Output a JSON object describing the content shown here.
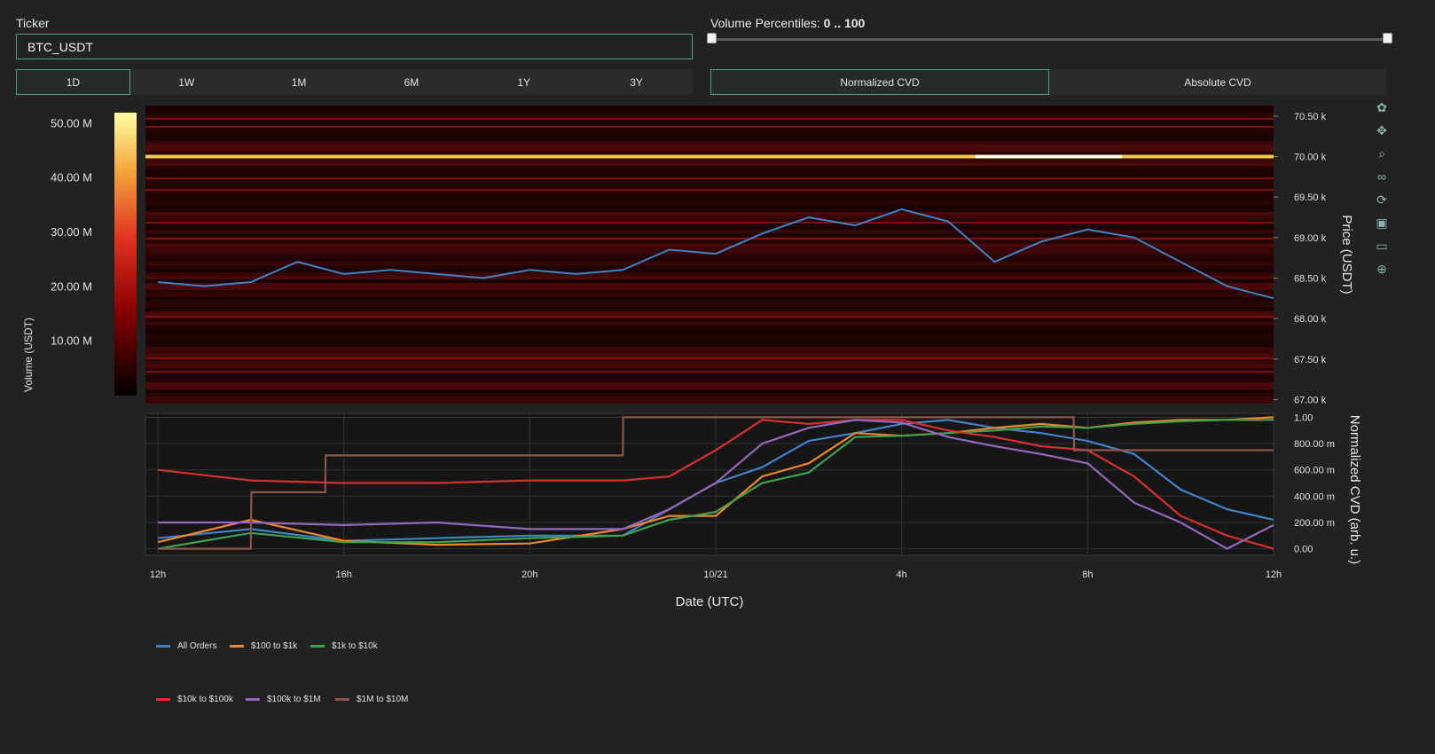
{
  "ticker": {
    "label": "Ticker",
    "value": "BTC_USDT"
  },
  "timeframes": [
    "1D",
    "1W",
    "1M",
    "6M",
    "1Y",
    "3Y"
  ],
  "timeframe_selected": "1D",
  "volume_percentiles": {
    "label": "Volume Percentiles:",
    "value": "0 .. 100",
    "min": 0,
    "max": 100
  },
  "cvd_modes": [
    "Normalized CVD",
    "Absolute CVD"
  ],
  "cvd_mode_selected": "Normalized CVD",
  "colorbar": {
    "title": "Volume (USDT)",
    "ticks": [
      "50.00 M",
      "40.00 M",
      "30.00 M",
      "20.00 M",
      "10.00 M"
    ],
    "tick_values": [
      50,
      40,
      30,
      20,
      10
    ],
    "max": 52,
    "colors": [
      "#000000",
      "#8a0000",
      "#e03020",
      "#f4a83a",
      "#ffffa0"
    ]
  },
  "icons": [
    "plotly-logo-icon",
    "pan-icon",
    "zoom-icon",
    "lasso-icon",
    "reset-axes-icon",
    "download-icon",
    "comment-icon",
    "crosshair-icon"
  ],
  "chart_data": [
    {
      "type": "heatmap",
      "ylabel": "Price (USDT)",
      "yticks": [
        "70.50 k",
        "70.00 k",
        "69.50 k",
        "69.00 k",
        "68.50 k",
        "68.00 k",
        "67.50 k",
        "67.00 k"
      ],
      "ylim": [
        66950,
        70630
      ],
      "strong_levels": [
        70000
      ],
      "series": [
        {
          "name": "Price",
          "color": "#3f83c8",
          "x": [
            0,
            1,
            2,
            3,
            4,
            5,
            6,
            7,
            8,
            9,
            10,
            11,
            12,
            13,
            14,
            15,
            16,
            17,
            18,
            19,
            20,
            21,
            22,
            23,
            24
          ],
          "y": [
            68450,
            68400,
            68450,
            68700,
            68550,
            68600,
            68550,
            68500,
            68600,
            68550,
            68600,
            68850,
            68800,
            69050,
            69250,
            69150,
            69350,
            69200,
            68700,
            68950,
            69100,
            69000,
            68700,
            68400,
            68250
          ]
        }
      ]
    },
    {
      "type": "line",
      "xlabel": "Date (UTC)",
      "ylabel": "Normalized CVD (arb. u.)",
      "xticks": [
        "12h",
        "16h",
        "20h",
        "10/21",
        "4h",
        "8h",
        "12h"
      ],
      "yticks": [
        "1.00",
        "800.00 m",
        "600.00 m",
        "400.00 m",
        "200.00 m",
        "0.00"
      ],
      "xlim": [
        0,
        24
      ],
      "ylim": [
        -0.05,
        1.03
      ],
      "series": [
        {
          "name": "All Orders",
          "color": "#3f83c8",
          "x": [
            0,
            2,
            4,
            6,
            8,
            10,
            11,
            12,
            13,
            14,
            15,
            16,
            17,
            18,
            19,
            20,
            21,
            22,
            23,
            24
          ],
          "y": [
            0.08,
            0.15,
            0.06,
            0.08,
            0.1,
            0.1,
            0.3,
            0.5,
            0.62,
            0.82,
            0.88,
            0.95,
            0.98,
            0.92,
            0.88,
            0.82,
            0.72,
            0.45,
            0.3,
            0.22
          ]
        },
        {
          "name": "$100 to $1k",
          "color": "#f0862a",
          "x": [
            0,
            2,
            4,
            6,
            8,
            10,
            11,
            12,
            13,
            14,
            15,
            16,
            17,
            18,
            19,
            20,
            21,
            22,
            23,
            24
          ],
          "y": [
            0.05,
            0.22,
            0.06,
            0.03,
            0.04,
            0.15,
            0.25,
            0.25,
            0.55,
            0.65,
            0.88,
            0.86,
            0.88,
            0.92,
            0.95,
            0.92,
            0.96,
            0.98,
            0.98,
            1.0
          ]
        },
        {
          "name": "$1k to $10k",
          "color": "#3fa34d",
          "x": [
            0,
            2,
            4,
            6,
            8,
            10,
            11,
            12,
            13,
            14,
            15,
            16,
            17,
            18,
            19,
            20,
            21,
            22,
            23,
            24
          ],
          "y": [
            0.0,
            0.12,
            0.05,
            0.05,
            0.08,
            0.1,
            0.22,
            0.28,
            0.5,
            0.58,
            0.85,
            0.86,
            0.88,
            0.9,
            0.93,
            0.92,
            0.95,
            0.97,
            0.98,
            0.98
          ]
        },
        {
          "name": "$10k to $100k",
          "color": "#d8302e",
          "x": [
            0,
            2,
            4,
            6,
            8,
            10,
            11,
            12,
            13,
            14,
            15,
            16,
            17,
            18,
            19,
            20,
            21,
            22,
            23,
            24
          ],
          "y": [
            0.6,
            0.52,
            0.5,
            0.5,
            0.52,
            0.52,
            0.55,
            0.75,
            0.98,
            0.95,
            0.98,
            0.98,
            0.9,
            0.85,
            0.78,
            0.75,
            0.55,
            0.25,
            0.1,
            0.0
          ]
        },
        {
          "name": "$100k to $1M",
          "color": "#9467bd",
          "x": [
            0,
            2,
            4,
            6,
            8,
            10,
            11,
            12,
            13,
            14,
            15,
            16,
            17,
            18,
            19,
            20,
            21,
            22,
            23,
            24
          ],
          "y": [
            0.2,
            0.2,
            0.18,
            0.2,
            0.15,
            0.15,
            0.3,
            0.5,
            0.8,
            0.92,
            0.98,
            0.96,
            0.85,
            0.78,
            0.72,
            0.65,
            0.35,
            0.2,
            0.0,
            0.18
          ]
        },
        {
          "name": "$1M to $10M",
          "color": "#8c564b",
          "x": [
            0,
            2,
            2.01,
            3.6,
            3.61,
            10,
            10.01,
            19.7,
            19.71,
            24
          ],
          "y": [
            0.0,
            0.0,
            0.43,
            0.43,
            0.71,
            0.71,
            1.0,
            1.0,
            0.75,
            0.75
          ]
        }
      ]
    }
  ]
}
